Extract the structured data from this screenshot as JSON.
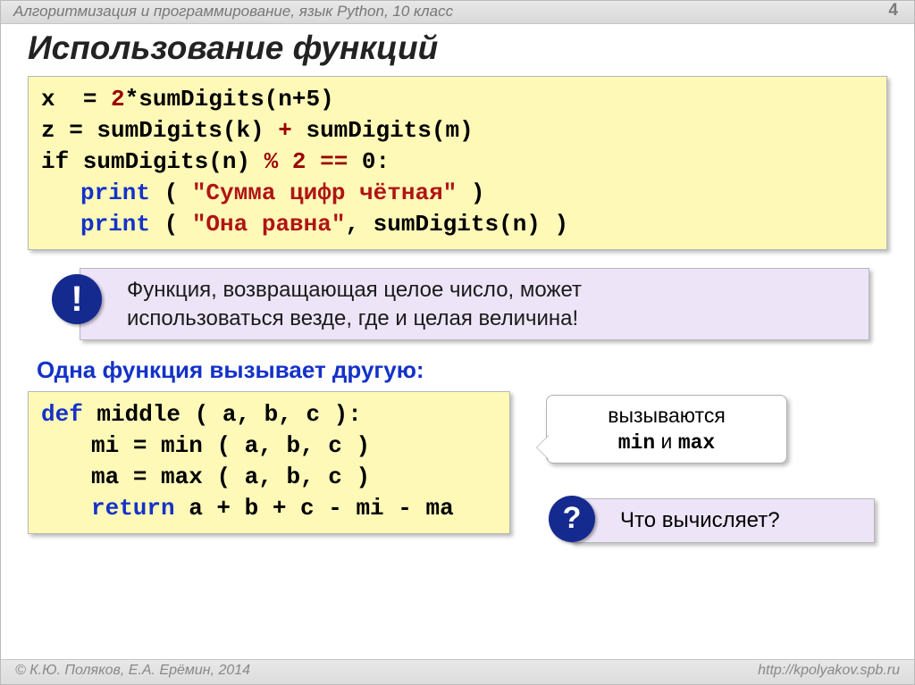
{
  "header": {
    "subject": "Алгоритмизация и программирование, язык Python, 10 класс",
    "page": "4"
  },
  "title": "Использование функций",
  "code1": {
    "l1_a": "x",
    "l1_b": "2",
    "l1_c": "*sumDigits(n+5)",
    "l2_a": "z",
    "l2_b": "sumDigits(k)",
    "l2_c": "sumDigits(m)",
    "l3_a": "if sumDigits(n)",
    "l3_pct": "%",
    "l3_b": "2",
    "l3_eq": "==",
    "l3_c": "0:",
    "l4_kw": "print",
    "l4_a": " ( ",
    "l4_str": "\"Сумма цифр чётная\"",
    "l4_b": " )",
    "l5_kw": "print",
    "l5_a": " ( ",
    "l5_str": "\"Она равна\"",
    "l5_b": ", sumDigits(n) )"
  },
  "note": {
    "badge": "!",
    "text1": "Функция, возвращающая целое число, может",
    "text2": "использоваться везде, где и целая величина!"
  },
  "subhead": "Одна функция вызывает другую:",
  "code2": {
    "l1_def": "def",
    "l1_rest": " middle ( a, b, c ):",
    "l2": "mi",
    "l2b": "min ( a, b, c )",
    "l3": "ma",
    "l3b": "max ( a, b, c )",
    "l4_ret": "return",
    "l4_rest": " a + b + c - mi - ma"
  },
  "callout": {
    "line1": "вызываются",
    "min": "min",
    "and": " и ",
    "max": "max"
  },
  "question": {
    "badge": "?",
    "text": " Что вычисляет?"
  },
  "footer": {
    "copyright": "© К.Ю. Поляков, Е.А. Ерёмин, 2014",
    "url": "http://kpolyakov.spb.ru"
  }
}
